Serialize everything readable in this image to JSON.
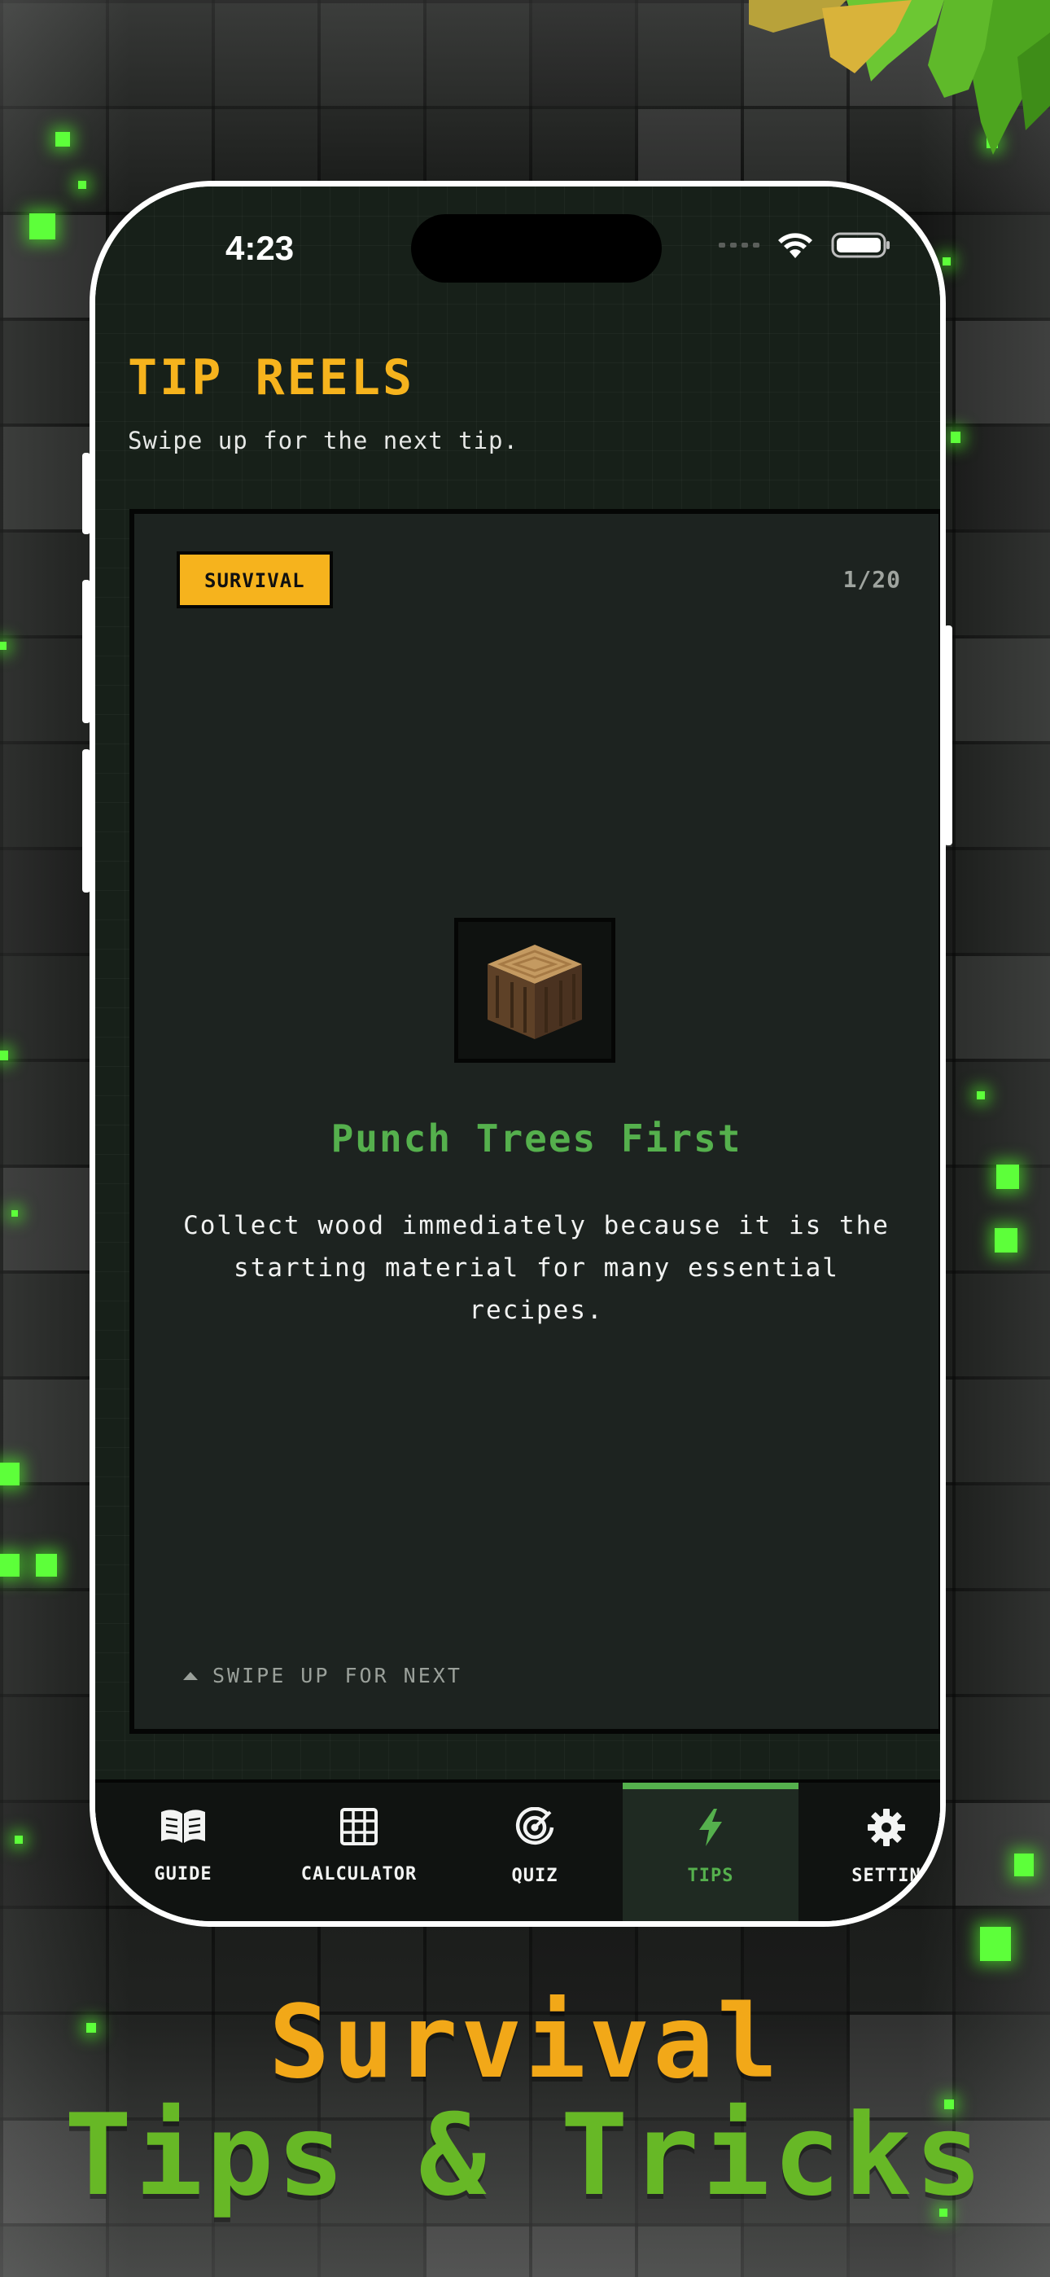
{
  "status_bar": {
    "time": "4:23",
    "icons": [
      "cellular-signal-icon",
      "wifi-icon",
      "battery-icon"
    ]
  },
  "screen": {
    "title": "TIP REELS",
    "subtitle": "Swipe up for the next tip."
  },
  "card": {
    "category": "SURVIVAL",
    "counter": "1/20",
    "item_icon": "oak-log-block-icon",
    "title": "Punch Trees First",
    "body": "Collect wood immediately because it is the starting material for many essential recipes.",
    "swipe_hint": "SWIPE UP FOR NEXT"
  },
  "tabbar": {
    "active": "TIPS",
    "tabs": [
      {
        "label": "GUIDE",
        "icon": "book-icon"
      },
      {
        "label": "CALCULATOR",
        "icon": "grid-icon"
      },
      {
        "label": "QUIZ",
        "icon": "target-icon"
      },
      {
        "label": "TIPS",
        "icon": "lightning-icon"
      },
      {
        "label": "SETTIN",
        "icon": "gear-icon"
      }
    ]
  },
  "headline": {
    "line1": "Survival",
    "line2": "Tips & Tricks"
  },
  "colors": {
    "accent_yellow": "#f6b31d",
    "accent_green": "#55b04d",
    "headline_orange": "#f2a818",
    "headline_green": "#67b826",
    "glow_green": "#5dff3a"
  }
}
